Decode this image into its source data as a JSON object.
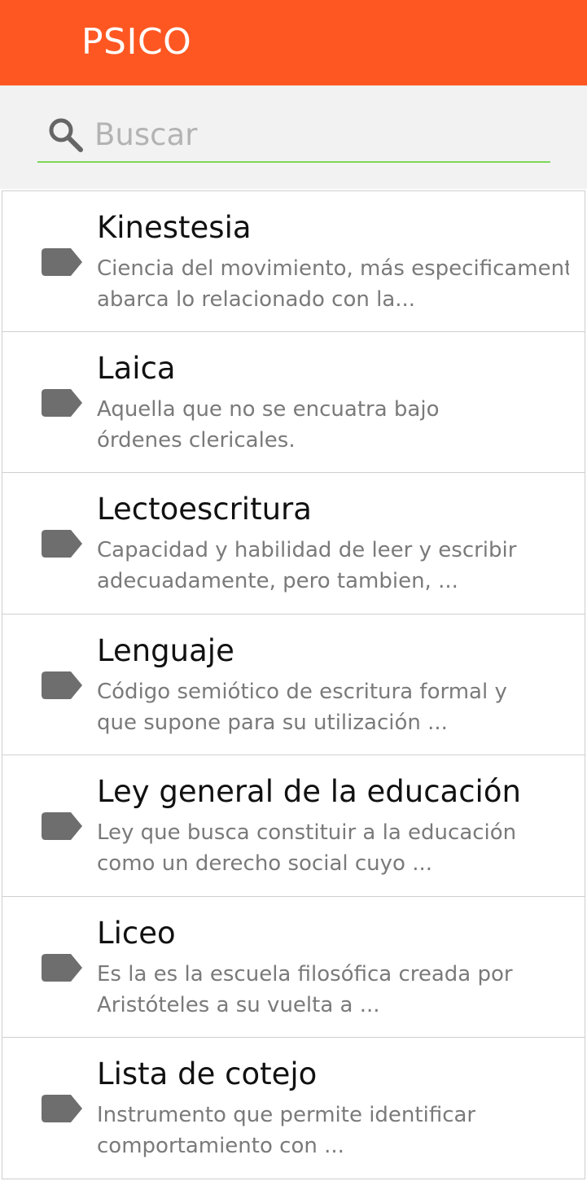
{
  "app_bar": {
    "title": "PSICO",
    "color": "#ff5722"
  },
  "search": {
    "icon": "search-icon",
    "placeholder": "Buscar",
    "value": "",
    "underline_color": "#7dd75a"
  },
  "terms": [
    {
      "icon": "tag-icon",
      "title": "Kinestesia",
      "desc_line1": "Ciencia del movimiento, más especificamente",
      "desc_line2": "abarca lo relacionado con la..."
    },
    {
      "icon": "tag-icon",
      "title": "Laica",
      "desc_line1": "Aquella que no se encuatra bajo",
      "desc_line2": "órdenes clericales."
    },
    {
      "icon": "tag-icon",
      "title": "Lectoescritura",
      "desc_line1": "Capacidad y habilidad de leer y escribir",
      "desc_line2": "adecuadamente, pero tambien, ..."
    },
    {
      "icon": "tag-icon",
      "title": "Lenguaje",
      "desc_line1": "Código semiótico de escritura formal y",
      "desc_line2": "que supone para su utilización ..."
    },
    {
      "icon": "tag-icon",
      "title": "Ley general de la educación",
      "desc_line1": "Ley que busca constituir a la educación",
      "desc_line2": "como un derecho social cuyo ..."
    },
    {
      "icon": "tag-icon",
      "title": "Liceo",
      "desc_line1": "Es la es la escuela filosófica creada por",
      "desc_line2": "Aristóteles a su vuelta a ..."
    },
    {
      "icon": "tag-icon",
      "title": "Lista de cotejo",
      "desc_line1": "Instrumento que permite identificar",
      "desc_line2": "comportamiento con ..."
    }
  ]
}
